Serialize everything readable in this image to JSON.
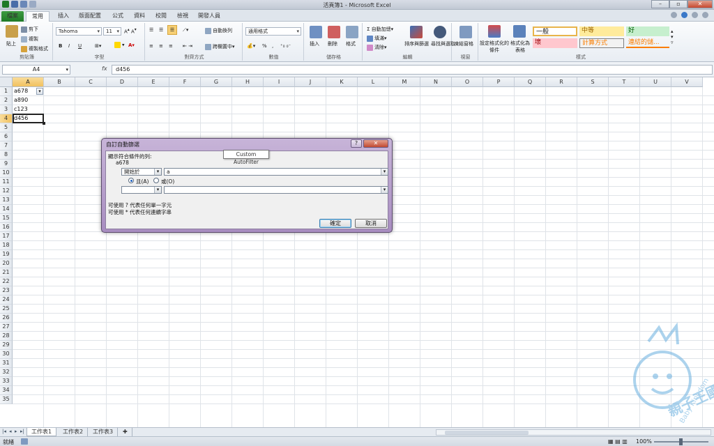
{
  "window": {
    "title": "活頁簿1 - Microsoft Excel"
  },
  "tabs": [
    "檔案",
    "常用",
    "插入",
    "版面配置",
    "公式",
    "資料",
    "校閱",
    "檢視",
    "開發人員"
  ],
  "ribbon": {
    "clipboard": {
      "paste": "貼上",
      "cut": "剪下",
      "copy": "複製",
      "format_painter": "複製格式",
      "label": "剪貼簿"
    },
    "font": {
      "name": "Tahoma",
      "size": "11",
      "bold": "B",
      "italic": "I",
      "underline": "U",
      "label": "字型"
    },
    "alignment": {
      "wrap": "自動換列",
      "merge": "跨欄置中",
      "label": "對齊方式"
    },
    "number": {
      "format": "通用格式",
      "percent": "%",
      "comma": ",",
      "label": "數值"
    },
    "cells": {
      "insert": "插入",
      "delete": "刪除",
      "format": "格式",
      "label": "儲存格"
    },
    "editing": {
      "autosum": "自動加總",
      "fill": "填滿",
      "clear": "清除",
      "sort": "排序與篩選",
      "find": "尋找與選取",
      "label": "編輯"
    },
    "view": {
      "freeze": "凍結窗格",
      "label": "視窗"
    },
    "styles": {
      "conditional": "設定格式化的條件",
      "as_table": "格式化為表格",
      "normal": "一般",
      "neutral": "中等",
      "good": "好",
      "bad": "壞",
      "calc": "計算方式",
      "link": "連結的儲...",
      "label": "樣式"
    }
  },
  "formula_bar": {
    "name_box": "A4",
    "fx": "fx",
    "content": "d456"
  },
  "grid": {
    "columns": [
      "A",
      "B",
      "C",
      "D",
      "E",
      "F",
      "G",
      "H",
      "I",
      "J",
      "K",
      "L",
      "M",
      "N",
      "O",
      "P",
      "Q",
      "R",
      "S",
      "T",
      "U",
      "V"
    ],
    "rows": [
      "1",
      "2",
      "3",
      "4",
      "5",
      "6",
      "7",
      "8",
      "9",
      "10",
      "11",
      "12",
      "13",
      "14",
      "15",
      "16",
      "17",
      "18",
      "19",
      "20",
      "21",
      "22",
      "23",
      "24",
      "25",
      "26",
      "27",
      "28",
      "29",
      "30",
      "31",
      "32",
      "33",
      "34",
      "35"
    ],
    "cells": [
      "a678",
      "a890",
      "c123",
      "d456"
    ]
  },
  "sheets": [
    "工作表1",
    "工作表2",
    "工作表3"
  ],
  "status": {
    "ready": "就緒",
    "zoom": "100%"
  },
  "dialog": {
    "title": "自訂自動篩選",
    "tooltip": "Custom AutoFilter",
    "show_rows": "顯示符合條件的列:",
    "field": "a678",
    "op1": "開始於",
    "val1": "a",
    "and_label": "且(A)",
    "or_label": "或(O)",
    "op2": "",
    "val2": "",
    "hint1": "可使用 ? 代表任何單一字元",
    "hint2": "可使用 * 代表任何連續字串",
    "ok": "確定",
    "cancel": "取消",
    "help": "?",
    "close": "✕"
  },
  "watermark": {
    "text": "親子王國",
    "sub": "Baby Kingdom"
  },
  "colors": {
    "accent": "#1f7a27",
    "selected_header": "#f1c15f",
    "dialog_frame": "#a88dc0"
  }
}
